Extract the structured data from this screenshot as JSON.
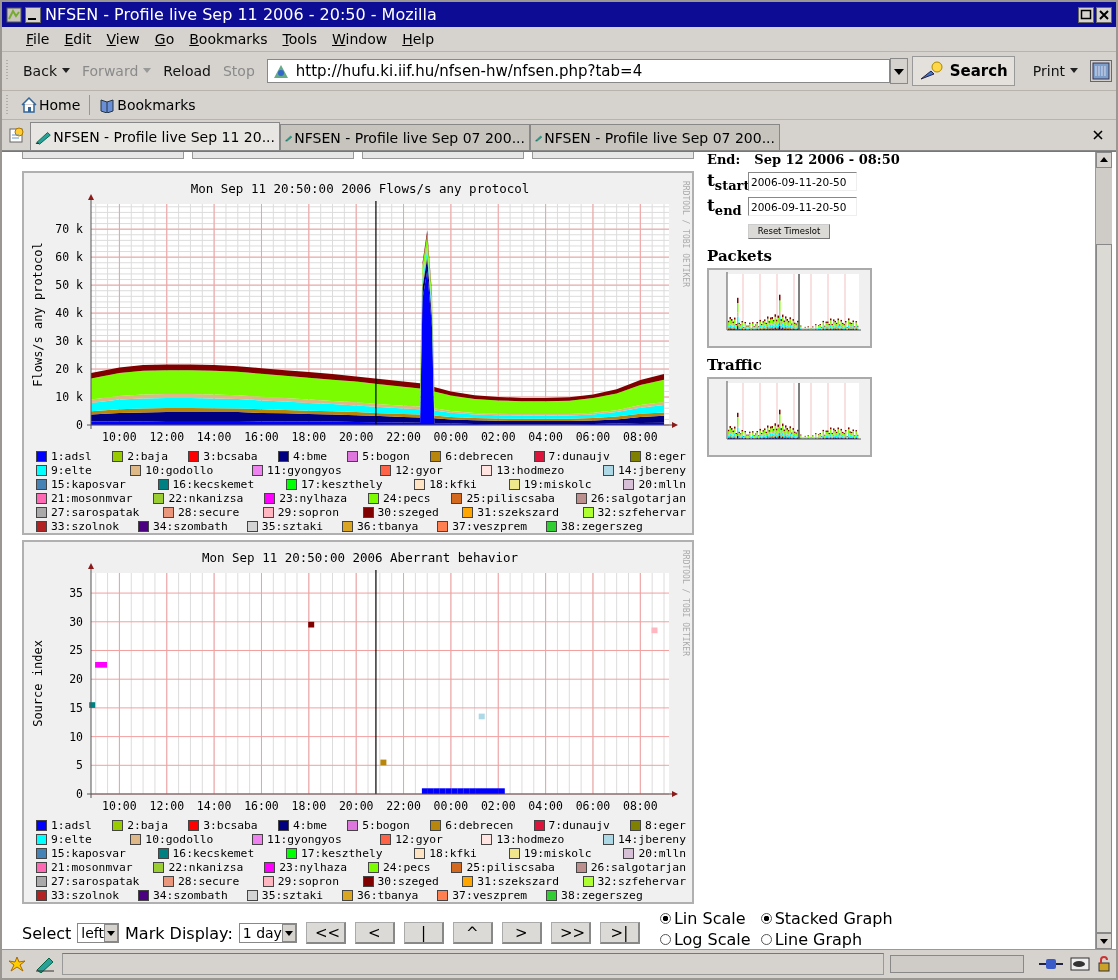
{
  "window": {
    "title": "NFSEN - Profile live Sep 11 2006 - 20:50 - Mozilla"
  },
  "menu": [
    "File",
    "Edit",
    "View",
    "Go",
    "Bookmarks",
    "Tools",
    "Window",
    "Help"
  ],
  "navigation": {
    "buttons": [
      {
        "label": "Back",
        "dropdown": true,
        "disabled": false
      },
      {
        "label": "Forward",
        "dropdown": true,
        "disabled": true
      },
      {
        "label": "Reload",
        "dropdown": false,
        "disabled": false
      },
      {
        "label": "Stop",
        "dropdown": false,
        "disabled": true
      }
    ],
    "url": "http://hufu.ki.iif.hu/nfsen-hw/nfsen.php?tab=4",
    "search": "Search",
    "print": "Print"
  },
  "personal_toolbar": [
    {
      "kind": "home",
      "label": "Home"
    },
    {
      "kind": "bookmarks",
      "label": "Bookmarks"
    }
  ],
  "tabs": [
    {
      "label": "NFSEN - Profile live Sep 11 20...",
      "selected": true
    },
    {
      "label": "NFSEN - Profile live Sep 07 200...",
      "selected": false
    },
    {
      "label": "NFSEN - Profile live Sep 07 200...",
      "selected": false
    }
  ],
  "charts": [
    {
      "credit": "RRDTOOL / TOBI OETIKER",
      "chart_data": {
        "type": "area",
        "stacked": true,
        "grid": true,
        "title": "Mon Sep 11 20:50:00 2006 Flows/s any protocol",
        "ylabel": "Flows/s any protocol",
        "x": [
          "2006-09-11 08:48",
          "2006-09-11 10:00",
          "2006-09-11 11:00",
          "2006-09-11 12:00",
          "2006-09-11 13:00",
          "2006-09-11 14:00",
          "2006-09-11 15:00",
          "2006-09-11 16:00",
          "2006-09-11 17:00",
          "2006-09-11 18:00",
          "2006-09-11 19:00",
          "2006-09-11 20:00",
          "2006-09-11 21:00",
          "2006-09-11 22:00",
          "2006-09-11 22:42",
          "2006-09-11 22:48",
          "2006-09-11 23:00",
          "2006-09-11 23:12",
          "2006-09-11 23:18",
          "2006-09-12 00:00",
          "2006-09-12 01:00",
          "2006-09-12 02:00",
          "2006-09-12 03:00",
          "2006-09-12 04:00",
          "2006-09-12 05:00",
          "2006-09-12 06:00",
          "2006-09-12 07:00",
          "2006-09-12 08:00",
          "2006-09-12 09:00"
        ],
        "xlim": [
          "2006-09-11 08:48",
          "2006-09-12 09:00"
        ],
        "ylim": [
          0,
          79
        ],
        "xticks": [
          {
            "value": "2006-09-11 10:00",
            "label": "10:00"
          },
          {
            "value": "2006-09-11 12:00",
            "label": "12:00"
          },
          {
            "value": "2006-09-11 14:00",
            "label": "14:00"
          },
          {
            "value": "2006-09-11 16:00",
            "label": "16:00"
          },
          {
            "value": "2006-09-11 18:00",
            "label": "18:00"
          },
          {
            "value": "2006-09-11 20:00",
            "label": "20:00"
          },
          {
            "value": "2006-09-11 22:00",
            "label": "22:00"
          },
          {
            "value": "2006-09-12 00:00",
            "label": "00:00"
          },
          {
            "value": "2006-09-12 02:00",
            "label": "02:00"
          },
          {
            "value": "2006-09-12 04:00",
            "label": "04:00"
          },
          {
            "value": "2006-09-12 06:00",
            "label": "06:00"
          },
          {
            "value": "2006-09-12 08:00",
            "label": "08:00"
          }
        ],
        "yticks": [
          {
            "value": 0,
            "label": "0"
          },
          {
            "value": 10,
            "label": "10 k"
          },
          {
            "value": 20,
            "label": "20 k"
          },
          {
            "value": 30,
            "label": "30 k"
          },
          {
            "value": 40,
            "label": "40 k"
          },
          {
            "value": 50,
            "label": "50 k"
          },
          {
            "value": 60,
            "label": "60 k"
          },
          {
            "value": 70,
            "label": "70 k"
          }
        ],
        "series": [
          {
            "color": "#0000ff",
            "values": [
              1.2,
              1.3,
              1.3,
              1.4,
              1.4,
              1.4,
              1.4,
              1.3,
              1.3,
              1.2,
              1.2,
              1.1,
              1.0,
              0.9,
              0.8,
              45,
              55,
              35,
              0.6,
              0.5,
              0.4,
              0.3,
              0.3,
              0.3,
              0.3,
              0.4,
              0.5,
              0.7,
              0.8
            ]
          },
          {
            "color": "#000080",
            "values": [
              2.5,
              3,
              3.2,
              3.3,
              3.3,
              3.2,
              3.2,
              3,
              2.9,
              2.7,
              2.6,
              2.4,
              2.2,
              2,
              1.9,
              4,
              5,
              3,
              1.8,
              1.5,
              1.3,
              1.2,
              1.1,
              1.1,
              1.1,
              1.2,
              1.5,
              2.2,
              2.5
            ]
          },
          {
            "color": "#b8860b",
            "values": [
              1.2,
              1.3,
              1.4,
              1.4,
              1.4,
              1.4,
              1.3,
              1.3,
              1.2,
              1.2,
              1.1,
              1.1,
              1,
              1,
              1,
              1,
              1,
              1,
              1,
              0.9,
              0.8,
              0.8,
              0.8,
              0.8,
              0.8,
              0.9,
              1,
              1.1,
              1.2
            ]
          },
          {
            "color": "#00ffff",
            "values": [
              3,
              3.5,
              3.6,
              3.6,
              3.6,
              3.5,
              3.4,
              3.2,
              3,
              2.8,
              2.6,
              2.4,
              2.2,
              2,
              1.9,
              2,
              2,
              2,
              1.8,
              1.5,
              1.3,
              1.2,
              1.2,
              1.2,
              1.2,
              1.3,
              1.6,
              2.2,
              2.6
            ]
          },
          {
            "color": "#deb887",
            "values": [
              1.2,
              1.3,
              1.4,
              1.4,
              1.4,
              1.4,
              1.3,
              1.3,
              1.2,
              1.2,
              1.1,
              1.1,
              1,
              1,
              1,
              1,
              1,
              1,
              0.8,
              0.6,
              0.5,
              0.5,
              0.5,
              0.5,
              0.5,
              0.6,
              0.7,
              0.9,
              1.1
            ]
          },
          {
            "color": "#7cfc00",
            "values": [
              7.5,
              8.2,
              8.5,
              8.5,
              8.5,
              8.5,
              8.4,
              8.2,
              8,
              7.8,
              7.6,
              7.4,
              7.2,
              6.8,
              6.5,
              4,
              4,
              4,
              6,
              5.5,
              5,
              4.8,
              4.6,
              4.6,
              4.8,
              5.2,
              6,
              7.2,
              8
            ]
          },
          {
            "color": "#800000",
            "values": [
              2,
              2,
              2,
              2,
              2,
              2,
              2,
              2,
              2,
              2,
              2,
              1.8,
              1.8,
              1.8,
              1.8,
              1,
              1.5,
              1,
              1.6,
              1.5,
              1.3,
              1.2,
              1.2,
              1.2,
              1.2,
              1.3,
              1.5,
              1.8,
              2
            ]
          }
        ],
        "ref_lines": [
          {
            "axis": "x",
            "value": "2006-09-11 20:50"
          }
        ]
      },
      "legend": [
        {
          "label": "1:adsl",
          "color": "#0000ff"
        },
        {
          "label": "2:baja",
          "color": "#99cc00"
        },
        {
          "label": "3:bcsaba",
          "color": "#ff0000"
        },
        {
          "label": "4:bme",
          "color": "#000080"
        },
        {
          "label": "5:bogon",
          "color": "#dd77dd"
        },
        {
          "label": "6:debrecen",
          "color": "#b8860b"
        },
        {
          "label": "7:dunaujv",
          "color": "#dc143c"
        },
        {
          "label": "8:eger",
          "color": "#808000"
        },
        {
          "label": "9:elte",
          "color": "#00ffff"
        },
        {
          "label": "10:godollo",
          "color": "#deb887"
        },
        {
          "label": "11:gyongyos",
          "color": "#ee82ee"
        },
        {
          "label": "12:gyor",
          "color": "#ff6347"
        },
        {
          "label": "13:hodmezo",
          "color": "#ffe4e1"
        },
        {
          "label": "14:jbereny",
          "color": "#add8e6"
        },
        {
          "label": "15:kaposvar",
          "color": "#4682b4"
        },
        {
          "label": "16:kecskemet",
          "color": "#008080"
        },
        {
          "label": "17:keszthely",
          "color": "#00ff00"
        },
        {
          "label": "18:kfki",
          "color": "#ffe4c4"
        },
        {
          "label": "19:miskolc",
          "color": "#f0e68c"
        },
        {
          "label": "20:mlln",
          "color": "#d8bfd8"
        },
        {
          "label": "21:mosonmvar",
          "color": "#ff69b4"
        },
        {
          "label": "22:nkanizsa",
          "color": "#9acd32"
        },
        {
          "label": "23:nylhaza",
          "color": "#ff00ff"
        },
        {
          "label": "24:pecs",
          "color": "#7cfc00"
        },
        {
          "label": "25:piliscsaba",
          "color": "#d2691e"
        },
        {
          "label": "26:salgotarjan",
          "color": "#bc8f8f"
        },
        {
          "label": "27:sarospatak",
          "color": "#a9a9a9"
        },
        {
          "label": "28:secure",
          "color": "#e9967a"
        },
        {
          "label": "29:sopron",
          "color": "#ffb6c1"
        },
        {
          "label": "30:szeged",
          "color": "#800000"
        },
        {
          "label": "31:szekszard",
          "color": "#ffa500"
        },
        {
          "label": "32:szfehervar",
          "color": "#adff2f"
        },
        {
          "label": "33:szolnok",
          "color": "#b22222"
        },
        {
          "label": "34:szombath",
          "color": "#4b0082"
        },
        {
          "label": "35:sztaki",
          "color": "#d3d3d3"
        },
        {
          "label": "36:tbanya",
          "color": "#daa520"
        },
        {
          "label": "37:veszprem",
          "color": "#ff7f50"
        },
        {
          "label": "38:zegerszeg",
          "color": "#32cd32"
        }
      ]
    },
    {
      "credit": "RRDTOOL / TOBI OETIKER",
      "chart_data": {
        "type": "scatter",
        "grid": true,
        "title": "Mon Sep 11 20:50:00 2006 Aberrant behavior",
        "ylabel": "Source index",
        "xlim": [
          "2006-09-11 08:48",
          "2006-09-12 09:00"
        ],
        "ylim": [
          0,
          38.5
        ],
        "xticks": [
          {
            "value": "2006-09-11 10:00",
            "label": "10:00"
          },
          {
            "value": "2006-09-11 12:00",
            "label": "12:00"
          },
          {
            "value": "2006-09-11 14:00",
            "label": "14:00"
          },
          {
            "value": "2006-09-11 16:00",
            "label": "16:00"
          },
          {
            "value": "2006-09-11 18:00",
            "label": "18:00"
          },
          {
            "value": "2006-09-11 20:00",
            "label": "20:00"
          },
          {
            "value": "2006-09-11 22:00",
            "label": "22:00"
          },
          {
            "value": "2006-09-12 00:00",
            "label": "00:00"
          },
          {
            "value": "2006-09-12 02:00",
            "label": "02:00"
          },
          {
            "value": "2006-09-12 04:00",
            "label": "04:00"
          },
          {
            "value": "2006-09-12 06:00",
            "label": "06:00"
          },
          {
            "value": "2006-09-12 08:00",
            "label": "08:00"
          }
        ],
        "yticks": [
          0,
          5,
          10,
          15,
          20,
          25,
          30,
          35
        ],
        "series": [
          {
            "color": "#008080",
            "x": [
              "2006-09-11 08:51"
            ],
            "values": [
              15.5
            ]
          },
          {
            "color": "#ff00ff",
            "x": [
              "2006-09-11 09:06",
              "2006-09-11 09:21"
            ],
            "values": [
              22.5,
              22.5
            ]
          },
          {
            "color": "#800000",
            "x": [
              "2006-09-11 18:06"
            ],
            "values": [
              29.5
            ]
          },
          {
            "color": "#b8860b",
            "x": [
              "2006-09-11 21:09"
            ],
            "values": [
              5.5
            ]
          },
          {
            "color": "#add8e6",
            "x": [
              "2006-09-12 01:18"
            ],
            "values": [
              13.5
            ]
          },
          {
            "color": "#ffb6c1",
            "x": [
              "2006-09-12 08:36"
            ],
            "values": [
              28.5
            ]
          },
          {
            "color": "#0000ff",
            "x": [
              "2006-09-11 22:54",
              "2006-09-11 23:09",
              "2006-09-11 23:24",
              "2006-09-11 23:39",
              "2006-09-11 23:54",
              "2006-09-12 00:09",
              "2006-09-12 00:24",
              "2006-09-12 00:39",
              "2006-09-12 00:54",
              "2006-09-12 01:09",
              "2006-09-12 01:24",
              "2006-09-12 01:39",
              "2006-09-12 01:54",
              "2006-09-12 02:09"
            ],
            "values": [
              0.5,
              0.5,
              0.5,
              0.5,
              0.5,
              0.5,
              0.5,
              0.5,
              0.5,
              0.5,
              0.5,
              0.5,
              0.5,
              0.5
            ]
          }
        ],
        "ref_lines": [
          {
            "axis": "x",
            "value": "2006-09-11 20:50"
          }
        ]
      },
      "legend": [
        {
          "label": "1:adsl",
          "color": "#0000ff"
        },
        {
          "label": "2:baja",
          "color": "#99cc00"
        },
        {
          "label": "3:bcsaba",
          "color": "#ff0000"
        },
        {
          "label": "4:bme",
          "color": "#000080"
        },
        {
          "label": "5:bogon",
          "color": "#dd77dd"
        },
        {
          "label": "6:debrecen",
          "color": "#b8860b"
        },
        {
          "label": "7:dunaujv",
          "color": "#dc143c"
        },
        {
          "label": "8:eger",
          "color": "#808000"
        },
        {
          "label": "9:elte",
          "color": "#00ffff"
        },
        {
          "label": "10:godollo",
          "color": "#deb887"
        },
        {
          "label": "11:gyongyos",
          "color": "#ee82ee"
        },
        {
          "label": "12:gyor",
          "color": "#ff6347"
        },
        {
          "label": "13:hodmezo",
          "color": "#ffe4e1"
        },
        {
          "label": "14:jbereny",
          "color": "#add8e6"
        },
        {
          "label": "15:kaposvar",
          "color": "#4682b4"
        },
        {
          "label": "16:kecskemet",
          "color": "#008080"
        },
        {
          "label": "17:keszthely",
          "color": "#00ff00"
        },
        {
          "label": "18:kfki",
          "color": "#ffe4c4"
        },
        {
          "label": "19:miskolc",
          "color": "#f0e68c"
        },
        {
          "label": "20:mlln",
          "color": "#d8bfd8"
        },
        {
          "label": "21:mosonmvar",
          "color": "#ff69b4"
        },
        {
          "label": "22:nkanizsa",
          "color": "#9acd32"
        },
        {
          "label": "23:nylhaza",
          "color": "#ff00ff"
        },
        {
          "label": "24:pecs",
          "color": "#7cfc00"
        },
        {
          "label": "25:piliscsaba",
          "color": "#d2691e"
        },
        {
          "label": "26:salgotarjan",
          "color": "#bc8f8f"
        },
        {
          "label": "27:sarospatak",
          "color": "#a9a9a9"
        },
        {
          "label": "28:secure",
          "color": "#e9967a"
        },
        {
          "label": "29:sopron",
          "color": "#ffb6c1"
        },
        {
          "label": "30:szeged",
          "color": "#800000"
        },
        {
          "label": "31:szekszard",
          "color": "#ffa500"
        },
        {
          "label": "32:szfehervar",
          "color": "#adff2f"
        },
        {
          "label": "33:szolnok",
          "color": "#b22222"
        },
        {
          "label": "34:szombath",
          "color": "#4b0082"
        },
        {
          "label": "35:sztaki",
          "color": "#d3d3d3"
        },
        {
          "label": "36:tbanya",
          "color": "#daa520"
        },
        {
          "label": "37:veszprem",
          "color": "#ff7f50"
        },
        {
          "label": "38:zegerszeg",
          "color": "#32cd32"
        }
      ]
    }
  ],
  "controls": {
    "select_label": "Select",
    "select_value": "left",
    "mark_label": "Mark Display:",
    "mark_value": "1 day",
    "buttons": [
      "<<",
      "<",
      "|",
      "^",
      ">",
      ">>",
      ">|"
    ],
    "options": [
      {
        "label": "Lin Scale",
        "selected": true
      },
      {
        "label": "Stacked Graph",
        "selected": true
      },
      {
        "label": "Log Scale",
        "selected": false
      },
      {
        "label": "Line Graph",
        "selected": false
      }
    ]
  },
  "timeslot": {
    "end_label": "End:",
    "end_value": "Sep 12 2006 - 08:50",
    "fields": [
      {
        "label": "t$_{start}$",
        "value": "2006-09-11-20-50"
      },
      {
        "label": "t$_{end}$",
        "value": "2006-09-11-20-50"
      }
    ],
    "reset_button": "Reset Timeslot"
  },
  "thumbnails": [
    {
      "title": "Packets"
    },
    {
      "title": "Traffic"
    }
  ]
}
